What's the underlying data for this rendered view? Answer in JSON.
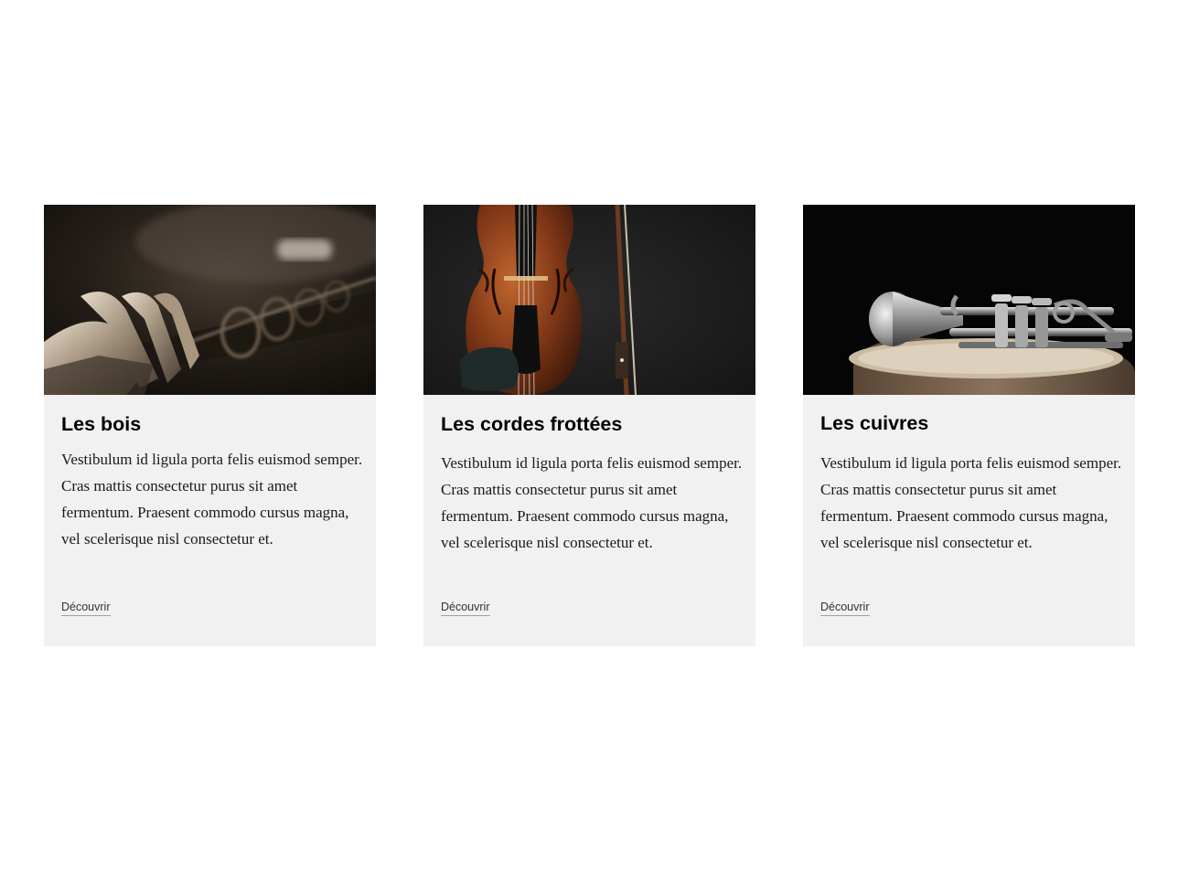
{
  "cards": [
    {
      "title": "Les bois",
      "text": "Vestibulum id ligula porta felis euismod semper. Cras mattis consectetur purus sit amet fermentum. Praesent commodo cursus magna, vel scelerisque nisl consectetur et.",
      "link": "Découvrir",
      "image": "clarinet-keys-photo"
    },
    {
      "title": "Les cordes frottées",
      "text": "Vestibulum id ligula porta felis euismod semper. Cras mattis consectetur purus sit amet fermentum. Praesent commodo cursus magna, vel scelerisque nisl consectetur et.",
      "link": "Découvrir",
      "image": "violin-and-bow-photo"
    },
    {
      "title": "Les cuivres",
      "text": "Vestibulum id ligula porta felis euismod semper. Cras mattis consectetur purus sit amet fermentum. Praesent commodo cursus magna, vel scelerisque nisl consectetur et.",
      "link": "Découvrir",
      "image": "trumpet-on-drum-photo"
    }
  ],
  "colors": {
    "card_background": "#f1f1f1",
    "page_background": "#ffffff",
    "title": "#000000",
    "body_text": "#1a1a1a",
    "link": "#333333"
  }
}
